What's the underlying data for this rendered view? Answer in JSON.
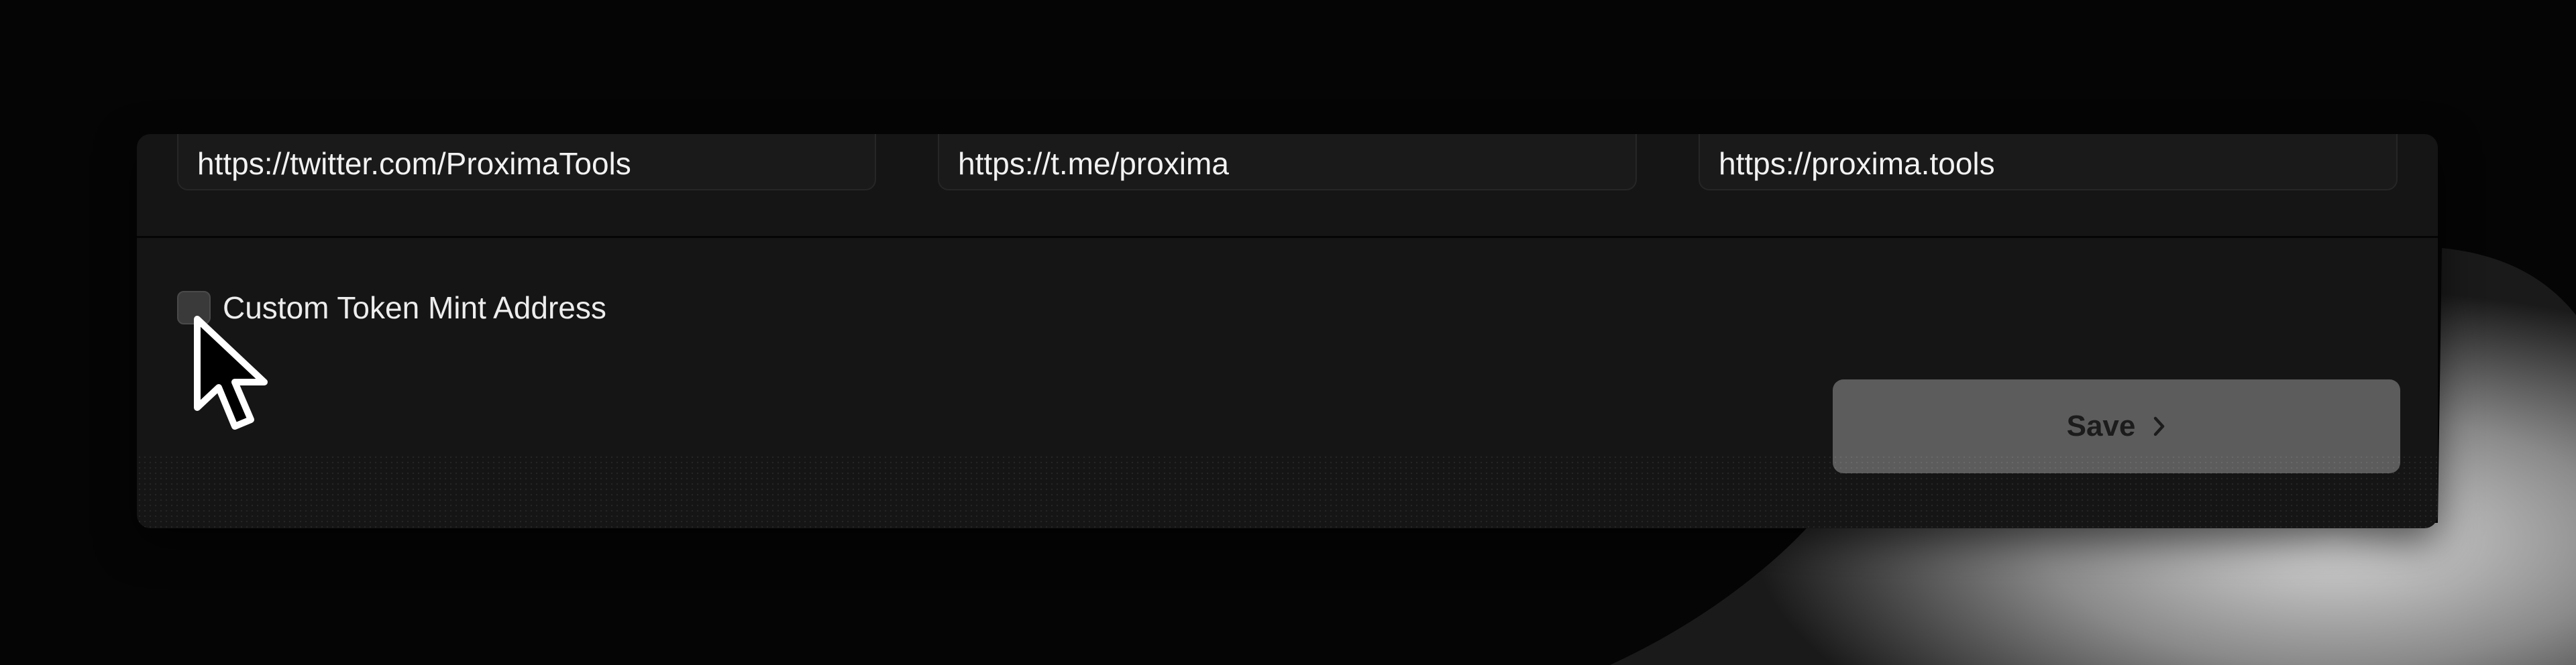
{
  "links": {
    "twitter_value": "https://twitter.com/ProximaTools",
    "telegram_value": "https://t.me/proxima",
    "website_value": "https://proxima.tools"
  },
  "options": {
    "custom_mint_label": "Custom Token Mint Address",
    "custom_mint_checked": false
  },
  "actions": {
    "save_label": "Save",
    "save_icon": "chevron-right-icon"
  },
  "colors": {
    "card_background": "#151515",
    "field_background": "#1a1a1a",
    "save_button_background": "#5c5c5c",
    "text_primary": "#f2f2f2"
  }
}
